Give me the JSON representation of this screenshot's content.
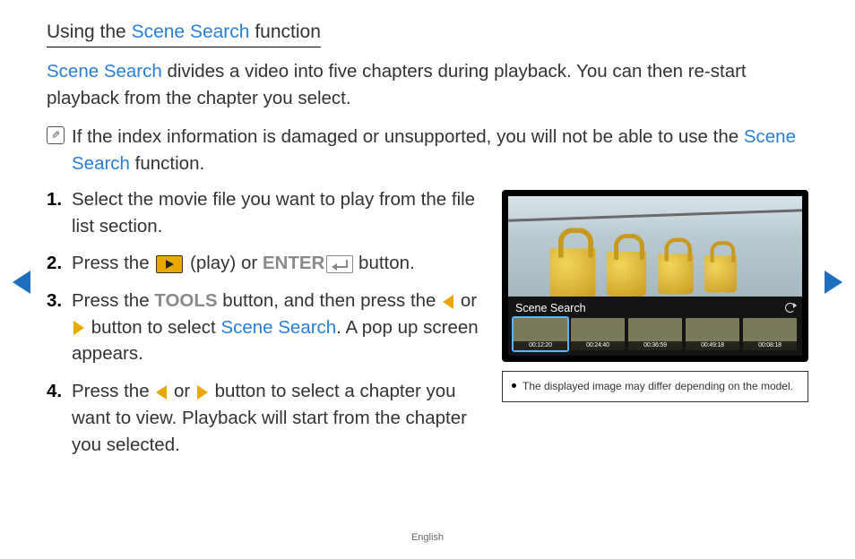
{
  "heading": {
    "prefix": "Using the ",
    "link": "Scene Search",
    "suffix": " function"
  },
  "intro": {
    "link": "Scene Search",
    "text": " divides a video into five chapters during playback. You can then re-start playback from the chapter you select."
  },
  "note": {
    "line1": "If the index information is damaged or unsupported, you will not be able to use the ",
    "link": "Scene Search",
    "line2": " function."
  },
  "steps": {
    "s1": "Select the movie file you want to play from the file list section.",
    "s2a": "Press the ",
    "s2b": " (play) or ",
    "s2_enter": "ENTER",
    "s2c": " button.",
    "s3a": "Press the ",
    "s3_tools": "TOOLS",
    "s3b": " button, and then press the ",
    "s3c": " or ",
    "s3d": " button to select ",
    "s3_link": "Scene Search",
    "s3e": ". A pop up screen appears.",
    "s4a": "Press the ",
    "s4b": " or ",
    "s4c": " button to select a chapter you want to view. Playback will start from the chapter you selected."
  },
  "screen": {
    "title": "Scene Search",
    "thumbs": [
      "00:12:20",
      "00:24:40",
      "00:36:59",
      "00:49:18",
      "00:08:18"
    ]
  },
  "caption": "The displayed image may differ depending on the model.",
  "footer": "English"
}
